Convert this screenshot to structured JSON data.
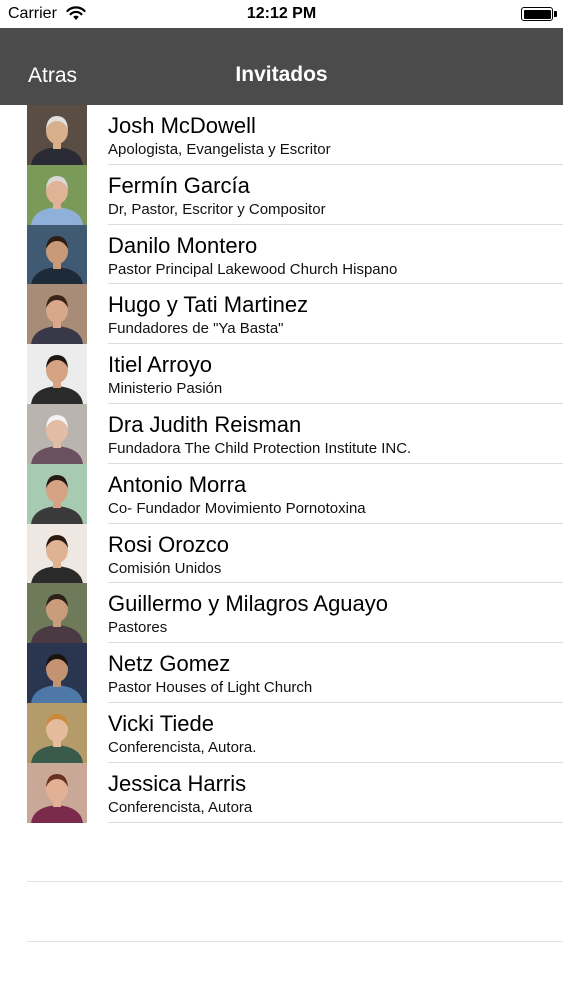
{
  "status_bar": {
    "carrier": "Carrier",
    "time": "12:12 PM"
  },
  "nav": {
    "back_label": "Atras",
    "title": "Invitados"
  },
  "guests": [
    {
      "name": "Josh McDowell",
      "role": "Apologista, Evangelista y Escritor",
      "bg": "#5a4d43",
      "skin": "#d9b08c",
      "hair": "#e0e0e0",
      "shirt": "#2b2b35"
    },
    {
      "name": "Fermín García",
      "role": "Dr, Pastor, Escritor y Compositor",
      "bg": "#7b9a5a",
      "skin": "#e0b296",
      "hair": "#d8d8d8",
      "shirt": "#8fb0d8"
    },
    {
      "name": "Danilo Montero",
      "role": "Pastor Principal Lakewood Church Hispano",
      "bg": "#3f5a72",
      "skin": "#c89a78",
      "hair": "#2b1e16",
      "shirt": "#1d2a3a"
    },
    {
      "name": "Hugo y Tati Martinez",
      "role": "Fundadores de \"Ya Basta\"",
      "bg": "#a88c78",
      "skin": "#d8a88a",
      "hair": "#3a2418",
      "shirt": "#383848"
    },
    {
      "name": "Itiel Arroyo",
      "role": "Ministerio Pasión",
      "bg": "#ececec",
      "skin": "#d6a382",
      "hair": "#1f1712",
      "shirt": "#2a2a2a"
    },
    {
      "name": "Dra Judith Reisman",
      "role": "Fundadora The Child Protection Institute INC.",
      "bg": "#b9b4ae",
      "skin": "#e2bca4",
      "hair": "#f2f2f2",
      "shirt": "#6b5060"
    },
    {
      "name": "Antonio Morra",
      "role": "Co- Fundador Movimiento Pornotoxina",
      "bg": "#a7cbb1",
      "skin": "#d5a384",
      "hair": "#251a14",
      "shirt": "#3a3a3a"
    },
    {
      "name": "Rosi Orozco",
      "role": "Comisión Unidos",
      "bg": "#efe8e2",
      "skin": "#e0b294",
      "hair": "#2a1a12",
      "shirt": "#2a2a2a"
    },
    {
      "name": "Guillermo y Milagros Aguayo",
      "role": "Pastores",
      "bg": "#6e7a5a",
      "skin": "#c99c7c",
      "hair": "#2d2018",
      "shirt": "#4a3a44"
    },
    {
      "name": "Netz Gomez",
      "role": "Pastor Houses of Light Church",
      "bg": "#2a3550",
      "skin": "#c49472",
      "hair": "#1a1410",
      "shirt": "#4d78a8"
    },
    {
      "name": "Vicki Tiede",
      "role": "Conferencista, Autora.",
      "bg": "#b59a6a",
      "skin": "#e4bc9c",
      "hair": "#c88a3a",
      "shirt": "#3a5a4a"
    },
    {
      "name": "Jessica Harris",
      "role": "Conferencista, Autora",
      "bg": "#c9a898",
      "skin": "#e2b094",
      "hair": "#6a3020",
      "shirt": "#7a2a4a"
    }
  ]
}
